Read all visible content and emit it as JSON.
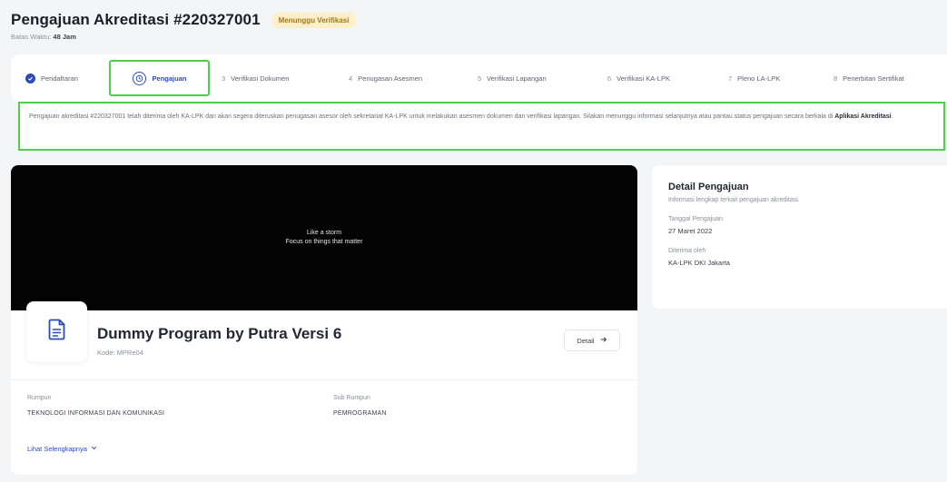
{
  "header": {
    "title": "Pengajuan Akreditasi #220327001",
    "status_badge": "Menunggu Verifikasi",
    "subtitle_prefix": "Batas Waktu:",
    "subtitle_value": "48 Jam"
  },
  "steps": [
    {
      "number": "",
      "label": "Pendaftaran",
      "state": "done"
    },
    {
      "number": "",
      "label": "Pengajuan",
      "state": "current"
    },
    {
      "number": "3",
      "label": "Verifikasi Dokumen",
      "state": "todo"
    },
    {
      "number": "4",
      "label": "Penugasan Asesmen",
      "state": "todo"
    },
    {
      "number": "5",
      "label": "Verifikasi Lapangan",
      "state": "todo"
    },
    {
      "number": "6",
      "label": "Verifikasi KA-LPK",
      "state": "todo"
    },
    {
      "number": "7",
      "label": "Pleno LA-LPK",
      "state": "todo"
    },
    {
      "number": "8",
      "label": "Penerbitan Sertifikat",
      "state": "todo"
    }
  ],
  "notice": {
    "text": "Pengajuan akreditasi #220327001 telah diterima oleh KA-LPK dan akan segera diteruskan penugasan asesor oleh sekretariat KA-LPK untuk melakukan asesmen dokumen dan verifikasi lapangan. Silakan menunggu informasi selanjutnya atau pantau status pengajuan secara berkala di",
    "link": "Aplikasi Akreditasi",
    "end": "."
  },
  "program": {
    "video_line1": "Like a storm",
    "video_line2": "Focus on things that matter",
    "name": "Dummy Program by Putra Versi 6",
    "code": "Kode: MPRe04",
    "detail_button": "Detail",
    "fields": [
      {
        "label": "Rumpun",
        "value": "TEKNOLOGI INFORMASI DAN KOMUNIKASI"
      },
      {
        "label": "Sub Rumpun",
        "value": "PEMROGRAMAN"
      }
    ],
    "show_more": "Lihat Selengkapnya"
  },
  "detail": {
    "title": "Detail Pengajuan",
    "subtitle": "Informasi lengkap terkait pengajuan akreditasi.",
    "items": [
      {
        "label": "Tanggal Pengajuan",
        "value": "27 Maret 2022"
      },
      {
        "label": "Diterima oleh",
        "value": "KA-LPK DKI Jakarta"
      }
    ]
  },
  "colors": {
    "accent": "#2b4bb5",
    "highlight": "#4ad24a",
    "badge_bg": "#fdf0c8",
    "badge_text": "#a1771a"
  }
}
